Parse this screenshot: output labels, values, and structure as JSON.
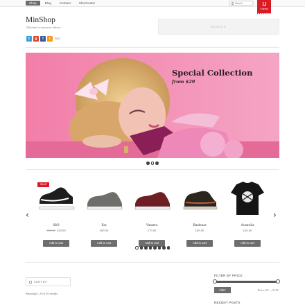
{
  "nav": {
    "items": [
      "Shop",
      "Blog",
      "Contact",
      "Shortcodes"
    ],
    "active": "Shop"
  },
  "search": {
    "placeholder": "Search"
  },
  "cart": {
    "label": "0 items",
    "icon": "cart-icon"
  },
  "header": {
    "logo": "MinShop",
    "tagline": "Minimal ecommerce theme",
    "social": [
      {
        "icon": "twitter-icon",
        "glyph": "t",
        "color": "#3aa1da"
      },
      {
        "icon": "google-plus-icon",
        "glyph": "g",
        "color": "#d6492f"
      },
      {
        "icon": "facebook-icon",
        "glyph": "f",
        "color": "#3b5a9a"
      },
      {
        "icon": "rss-icon",
        "glyph": "r",
        "color": "#f39a21"
      }
    ],
    "rss_label": "RSS",
    "banner_label": "BANNER"
  },
  "slider": {
    "title": "Special Collection",
    "subtitle": "from $29",
    "dot_count": 3,
    "active_dot": 1
  },
  "products": [
    {
      "name": "SK8",
      "old_price": "£55.00",
      "price": "£49.00",
      "sale": true,
      "sale_label": "SALE",
      "button": "Add to cart",
      "image": "shoe-black"
    },
    {
      "name": "Era",
      "old_price": "",
      "price": "£69.00",
      "sale": false,
      "button": "Add to cart",
      "image": "shoe-grey"
    },
    {
      "name": "Vansera",
      "old_price": "",
      "price": "£79.00",
      "sale": false,
      "button": "Add to cart",
      "image": "shoe-maroon"
    },
    {
      "name": "Bardenas",
      "old_price": "",
      "price": "£69.00",
      "sale": false,
      "button": "Add to cart",
      "image": "shoe-brown"
    },
    {
      "name": "Australia",
      "old_price": "",
      "price": "£26.00",
      "sale": false,
      "button": "Add to cart",
      "image": "tshirt-black"
    }
  ],
  "carousel": {
    "dot_count": 8,
    "active_dot": 0,
    "prev_icon": "chevron-left-icon",
    "next_icon": "chevron-right-icon",
    "prev_glyph": "‹",
    "next_glyph": "›"
  },
  "sort": {
    "label": "SORT BY",
    "icon": "sort-icon"
  },
  "results": {
    "text": "Showing 1–8 of 16 results"
  },
  "filter": {
    "title": "FILTER BY PRICE",
    "button": "Filter",
    "range_text": "Price: £9 — £118",
    "min_fraction": 0,
    "max_fraction": 1
  },
  "recent_posts": {
    "title": "RECENT POSTS"
  }
}
